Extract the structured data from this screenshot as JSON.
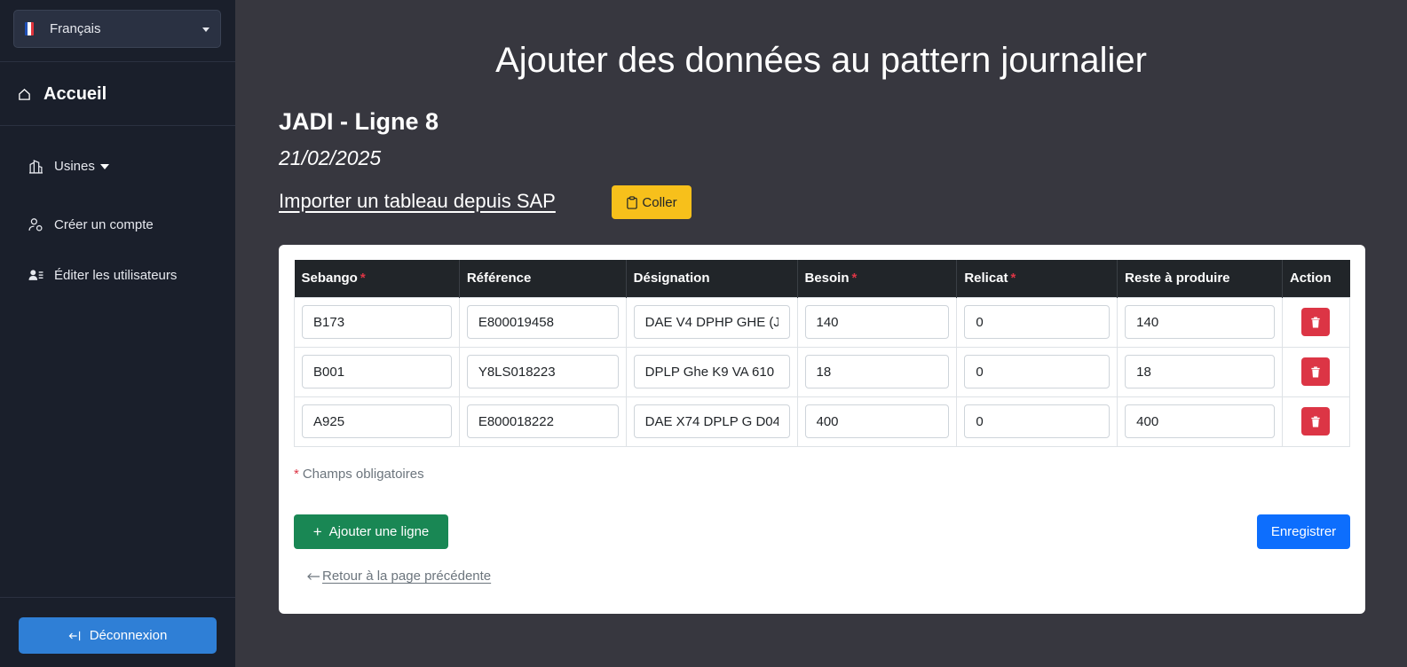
{
  "sidebar": {
    "language": "Français",
    "home": "Accueil",
    "items": [
      {
        "label": "Usines"
      },
      {
        "label": "Créer un compte"
      },
      {
        "label": "Éditer les utilisateurs"
      }
    ],
    "logout": "Déconnexion"
  },
  "main": {
    "title": "Ajouter des données au pattern journalier",
    "subtitle": "JADI - Ligne 8",
    "date": "21/02/2025",
    "import_label": "Importer un tableau depuis SAP",
    "paste_label": "Coller",
    "required_mark": "*",
    "table": {
      "headers": [
        "Sebango",
        "Référence",
        "Désignation",
        "Besoin",
        "Relicat",
        "Reste à produire",
        "Action"
      ],
      "rows": [
        [
          "B173",
          "E800019458",
          "DAE V4 DPHP GHE (J",
          "140",
          "0",
          "140"
        ],
        [
          "B001",
          "Y8LS018223",
          "DPLP Ghe K9 VA 610",
          "18",
          "0",
          "18"
        ],
        [
          "A925",
          "E800018222",
          "DAE X74 DPLP G D04",
          "400",
          "0",
          "400"
        ]
      ]
    },
    "required_note": "Champs obligatoires",
    "add_row_label": "Ajouter une ligne",
    "save_label": "Enregistrer",
    "back_label": " Retour à la page précédente"
  },
  "colors": {
    "sidebar_bg": "#1a1f2b",
    "main_bg": "#37373f",
    "paste_btn": "#f7c01b",
    "add_btn": "#198754",
    "save_btn": "#0d6efd",
    "delete_btn": "#dc3545",
    "logout_btn": "#2f7fd6"
  }
}
